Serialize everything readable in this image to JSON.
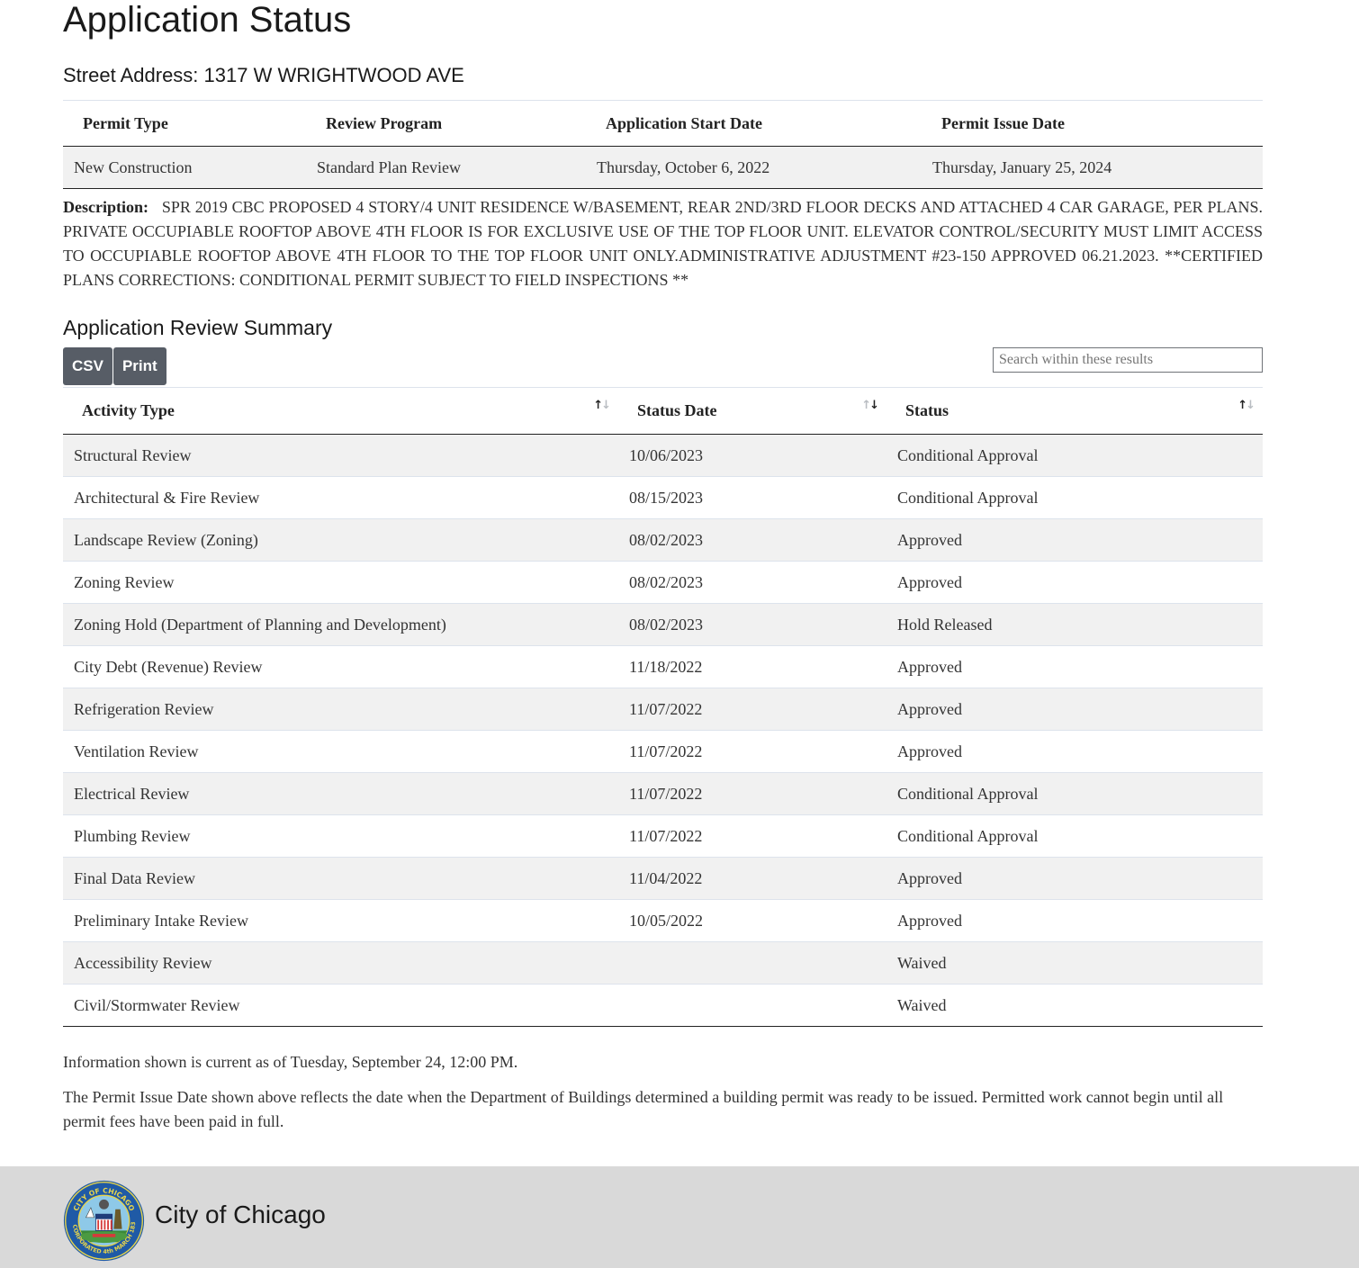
{
  "page": {
    "title": "Application Status",
    "address_label": "Street Address:",
    "address_value": "1317 W WRIGHTWOOD AVE"
  },
  "permit_summary": {
    "headers": [
      "Permit Type",
      "Review Program",
      "Application Start Date",
      "Permit Issue Date"
    ],
    "values": [
      "New Construction",
      "Standard Plan Review",
      "Thursday, October 6, 2022",
      "Thursday, January 25, 2024"
    ]
  },
  "description": {
    "label": "Description:",
    "text": "SPR 2019 CBC PROPOSED 4 STORY/4 UNIT RESIDENCE W/BASEMENT, REAR 2ND/3RD FLOOR DECKS AND ATTACHED 4 CAR GARAGE, PER PLANS. PRIVATE OCCUPIABLE ROOFTOP ABOVE 4TH FLOOR IS FOR EXCLUSIVE USE OF THE TOP FLOOR UNIT. ELEVATOR CONTROL/SECURITY MUST LIMIT ACCESS TO OCCUPIABLE ROOFTOP ABOVE 4TH FLOOR TO THE TOP FLOOR UNIT ONLY.ADMINISTRATIVE ADJUSTMENT #23-150 APPROVED 06.21.2023. **CERTIFIED PLANS CORRECTIONS: CONDITIONAL PERMIT SUBJECT TO FIELD INSPECTIONS **"
  },
  "review_summary": {
    "title": "Application Review Summary",
    "buttons": {
      "csv": "CSV",
      "print": "Print"
    },
    "search": {
      "placeholder": "Search within these results",
      "value": ""
    },
    "columns": [
      {
        "label": "Activity Type",
        "sort_icon": "sort-up-down-icon",
        "sort_state": "none"
      },
      {
        "label": "Status Date",
        "sort_icon": "sort-up-down-icon",
        "sort_state": "descending"
      },
      {
        "label": "Status",
        "sort_icon": "sort-up-down-icon",
        "sort_state": "none"
      }
    ],
    "rows": [
      {
        "activity": "Structural Review",
        "date": "10/06/2023",
        "status": "Conditional Approval"
      },
      {
        "activity": "Architectural & Fire Review",
        "date": "08/15/2023",
        "status": "Conditional Approval"
      },
      {
        "activity": "Landscape Review (Zoning)",
        "date": "08/02/2023",
        "status": "Approved"
      },
      {
        "activity": "Zoning Review",
        "date": "08/02/2023",
        "status": "Approved"
      },
      {
        "activity": "Zoning Hold (Department of Planning and Development)",
        "date": "08/02/2023",
        "status": "Hold Released"
      },
      {
        "activity": "City Debt (Revenue) Review",
        "date": "11/18/2022",
        "status": "Approved"
      },
      {
        "activity": "Refrigeration Review",
        "date": "11/07/2022",
        "status": "Approved"
      },
      {
        "activity": "Ventilation Review",
        "date": "11/07/2022",
        "status": "Approved"
      },
      {
        "activity": "Electrical Review",
        "date": "11/07/2022",
        "status": "Conditional Approval"
      },
      {
        "activity": "Plumbing Review",
        "date": "11/07/2022",
        "status": "Conditional Approval"
      },
      {
        "activity": "Final Data Review",
        "date": "11/04/2022",
        "status": "Approved"
      },
      {
        "activity": "Preliminary Intake Review",
        "date": "10/05/2022",
        "status": "Approved"
      },
      {
        "activity": "Accessibility Review",
        "date": "",
        "status": "Waived"
      },
      {
        "activity": "Civil/Stormwater Review",
        "date": "",
        "status": "Waived"
      }
    ]
  },
  "notes": {
    "current_as_of": "Information shown is current as of Tuesday, September 24, 12:00 PM.",
    "issue_date_note": "The Permit Issue Date shown above reflects the date when the Department of Buildings determined a building permit was ready to be issued. Permitted work cannot begin until all permit fees have been paid in full."
  },
  "footer": {
    "brand": "City of Chicago",
    "seal_icon": "city-of-chicago-seal-icon",
    "seal_text_top": "CITY OF CHICAGO",
    "seal_text_bottom": "INCORPORATED 4th MARCH 1837"
  },
  "colors": {
    "button_bg": "#575d66",
    "row_stripe": "#f1f1f1",
    "footer_bg": "#d9d9d9",
    "seal_blue": "#1f5aa6",
    "seal_gold": "#e8d44a"
  }
}
